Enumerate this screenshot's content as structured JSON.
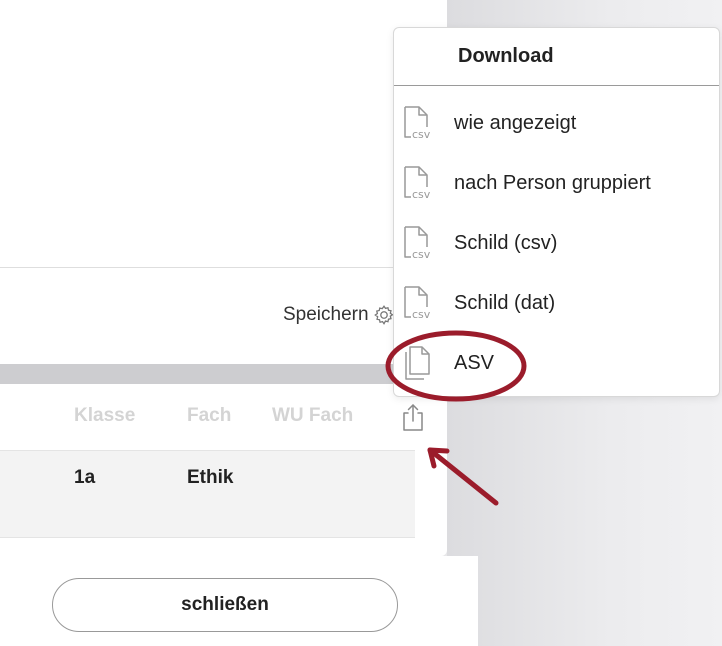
{
  "background": {
    "accent": "#9b1c2b"
  },
  "top_card": {
    "save_label": "Speichern"
  },
  "table": {
    "headers": [
      "Klasse",
      "Fach",
      "WU Fach"
    ],
    "rows": [
      [
        "1a",
        "Ethik",
        ""
      ]
    ]
  },
  "footer": {
    "close_label": "schließen"
  },
  "menu": {
    "title": "Download",
    "items": [
      {
        "label": "wie angezeigt",
        "icon": "csv-file-icon"
      },
      {
        "label": "nach Person gruppiert",
        "icon": "csv-file-icon"
      },
      {
        "label": "Schild (csv)",
        "icon": "csv-file-icon"
      },
      {
        "label": "Schild (dat)",
        "icon": "csv-file-icon"
      },
      {
        "label": "ASV",
        "icon": "copy-file-icon"
      }
    ],
    "icon_text": "csv"
  }
}
